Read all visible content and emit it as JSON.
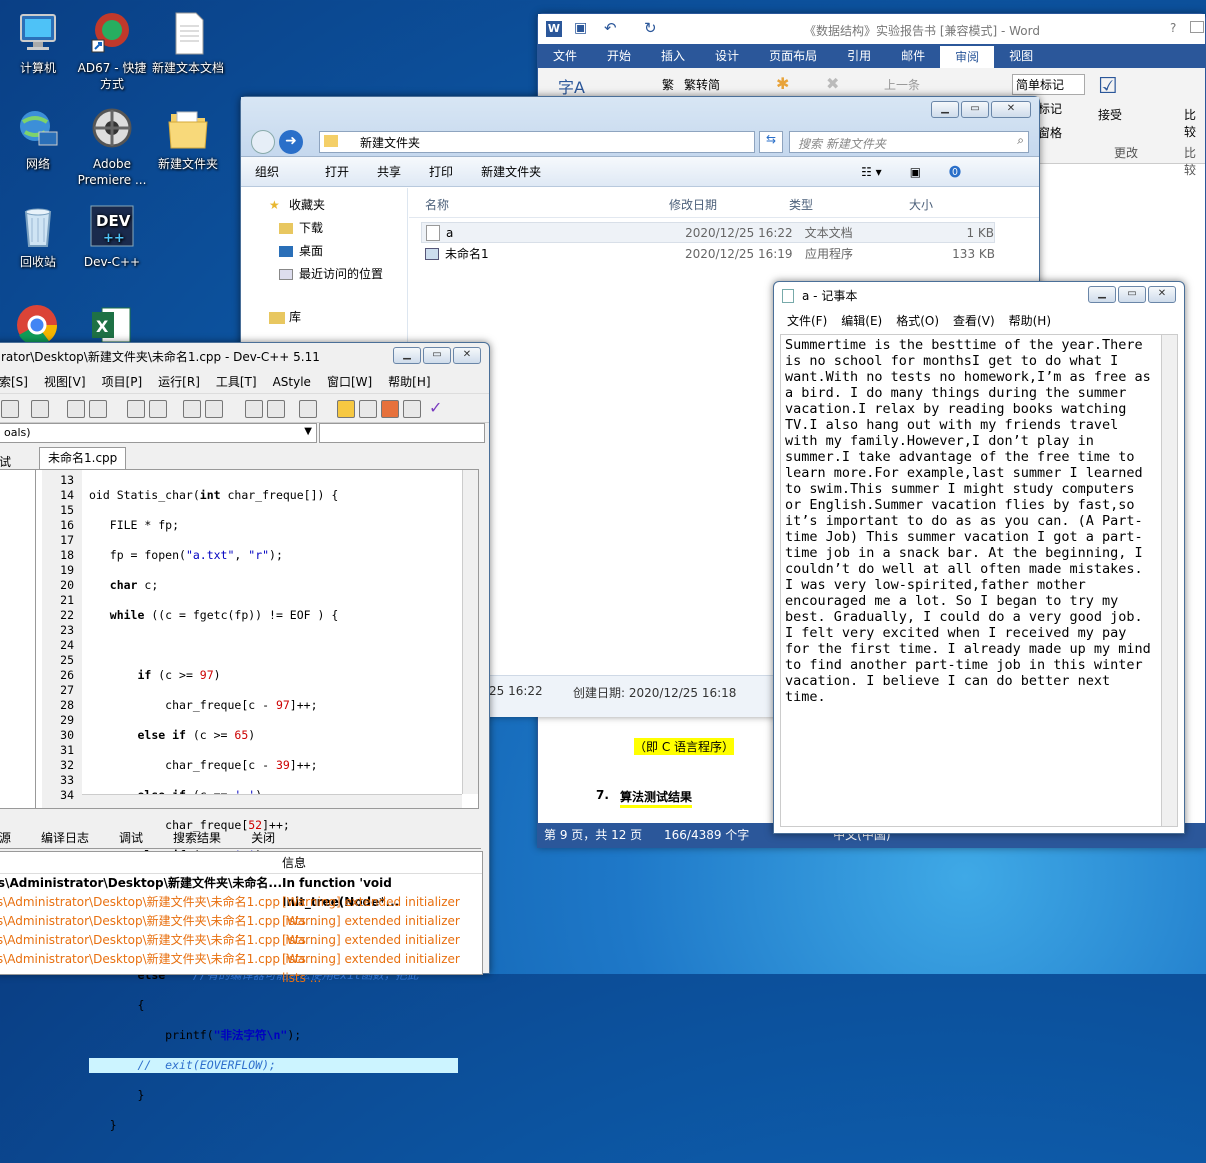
{
  "desktop": {
    "icons": [
      {
        "label": "计算机",
        "icon": "computer-icon"
      },
      {
        "label": "AD67 - 快捷方式",
        "icon": "shortcut-icon"
      },
      {
        "label": "新建文本文档",
        "icon": "text-document-icon"
      },
      {
        "label": "网络",
        "icon": "network-icon"
      },
      {
        "label": "Adobe Premiere ...",
        "icon": "premiere-icon"
      },
      {
        "label": "新建文件夹",
        "icon": "folder-icon"
      },
      {
        "label": "回收站",
        "icon": "recycle-bin-icon"
      },
      {
        "label": "Dev-C++",
        "icon": "devcpp-icon"
      }
    ]
  },
  "word": {
    "title": "《数据结构》实验报告书 [兼容模式] - Word",
    "help": "?",
    "tabs": [
      "文件",
      "开始",
      "插入",
      "设计",
      "页面布局",
      "引用",
      "邮件",
      "审阅",
      "视图"
    ],
    "active_tab": "审阅",
    "ribbon": {
      "convert": "繁转简",
      "prev": "上一条",
      "markup": "简单标记",
      "show_markup": "标记",
      "pane": "窗格",
      "accept": "接受",
      "changes_group": "更改",
      "compare": "比较",
      "compare_group": "比较"
    },
    "doc": {
      "line1": "（即 C 语言程序）",
      "heading_num": "7.",
      "heading": "算法测试结果"
    },
    "status": {
      "page": "第 9 页，共 12 页",
      "words": "166/4389 个字",
      "lang": "中文(中国)"
    }
  },
  "explorer": {
    "path": "新建文件夹",
    "search_placeholder": "搜索 新建文件夹",
    "commands": [
      "组织",
      "打开",
      "共享",
      "打印",
      "新建文件夹"
    ],
    "nav": [
      "收藏夹",
      "下载",
      "桌面",
      "最近访问的位置",
      "库"
    ],
    "columns": [
      "名称",
      "修改日期",
      "类型",
      "大小"
    ],
    "files": [
      {
        "name": "a",
        "date": "2020/12/25 16:22",
        "type": "文本文档",
        "size": "1 KB"
      },
      {
        "name": "未命名1",
        "date": "2020/12/25 16:19",
        "type": "应用程序",
        "size": "133 KB"
      }
    ],
    "details": {
      "modified": "25 16:22",
      "created": "创建日期: 2020/12/25 16:18"
    }
  },
  "devcpp": {
    "title": "rator\\Desktop\\新建文件夹\\未命名1.cpp - Dev-C++ 5.11",
    "menu": [
      "索[S]",
      "视图[V]",
      "项目[P]",
      "运行[R]",
      "工具[T]",
      "AStyle",
      "窗口[W]",
      "帮助[H]"
    ],
    "combo": "oals)",
    "left_tab": "试",
    "file_tab": "未命名1.cpp",
    "line_numbers": [
      "13",
      "14",
      "15",
      "16",
      "17",
      "18",
      "19",
      "20",
      "21",
      "22",
      "23",
      "24",
      "25",
      "26",
      "27",
      "28",
      "29",
      "30",
      "31",
      "32",
      "33",
      "34"
    ],
    "bottom_tabs": [
      "源",
      "编译日志",
      "调试",
      "搜索结果",
      "关闭"
    ],
    "msg_header": "信息",
    "messages": [
      {
        "file": "rs\\Administrator\\Desktop\\新建文件夹\\未命名...",
        "info": "In function 'void Init_tree(Node*..."
      },
      {
        "file": "rs\\Administrator\\Desktop\\新建文件夹\\未命名1.cpp",
        "info": "[Warning] extended initializer lists ..."
      },
      {
        "file": "rs\\Administrator\\Desktop\\新建文件夹\\未命名1.cpp",
        "info": "[Warning] extended initializer lists ..."
      },
      {
        "file": "rs\\Administrator\\Desktop\\新建文件夹\\未命名1.cpp",
        "info": "[Warning] extended initializer lists ..."
      },
      {
        "file": "rs\\Administrator\\Desktop\\新建文件夹\\未命名1.cpp",
        "info": "[Warning] extended initializer lists ..."
      }
    ]
  },
  "notepad": {
    "title": "a - 记事本",
    "menu": [
      "文件(F)",
      "编辑(E)",
      "格式(O)",
      "查看(V)",
      "帮助(H)"
    ],
    "text": "Summertime is the besttime of the year.There is no school for monthsI get to do what I want.With no tests no homework,I’m as free as a bird. I do many things during the summer vacation.I relax by reading books watching TV.I also hang out with my friends travel with my family.However,I don’t play in summer.I take advantage of the free time to learn more.For example,last summer I learned to swim.This summer I might study computers or English.Summer vacation flies by fast,so it’s important to do as as you can. (A Part-time Job) This summer vacation I got a part-time job in a snack bar. At the beginning, I couldn’t do well at all often made mistakes. I was very low-spirited,father mother encouraged me a lot. So I began to try my best. Gradually, I could do a very good job. I felt very excited when I received my pay for the first time. I already made up my mind to find another part-time job in this winter vacation. I believe I can do better next time."
  }
}
